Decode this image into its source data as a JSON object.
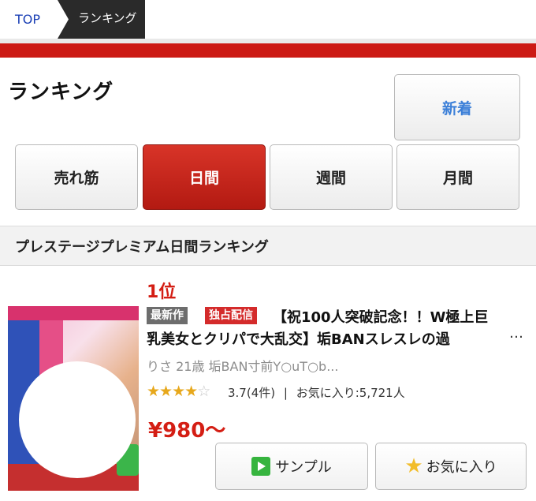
{
  "breadcrumb": {
    "top": "TOP",
    "current": "ランキング"
  },
  "colors": {
    "accent_red": "#cc1a14",
    "new_blue": "#3b7fd8",
    "rank_red": "#d41e14"
  },
  "page_title": "ランキング",
  "new_button": "新着",
  "tabs": [
    {
      "label": "売れ筋",
      "active": false
    },
    {
      "label": "日間",
      "active": true
    },
    {
      "label": "週間",
      "active": false
    },
    {
      "label": "月間",
      "active": false
    }
  ],
  "ranking_header": "プレステージプレミアム日間ランキング",
  "item": {
    "rank": "1位",
    "badges": {
      "new": "最新作",
      "exclusive": "独占配信"
    },
    "title_line1": "【祝100人突破記念！！W極上巨",
    "title_line2": "乳美女とクリパで大乱交】垢BANスレスレの過",
    "ellipsis": "…",
    "actress": "りさ 21歳 垢BAN寸前Y○uT○b...",
    "rating": 3.7,
    "rating_text": "3.7(4件)",
    "separator": "|",
    "favorites": "お気に入り:5,721人",
    "price": "¥980〜",
    "sample_button": "サンプル",
    "favorite_button": "お気に入り",
    "icons": {
      "sample": "play-icon",
      "favorite": "star-icon"
    }
  }
}
